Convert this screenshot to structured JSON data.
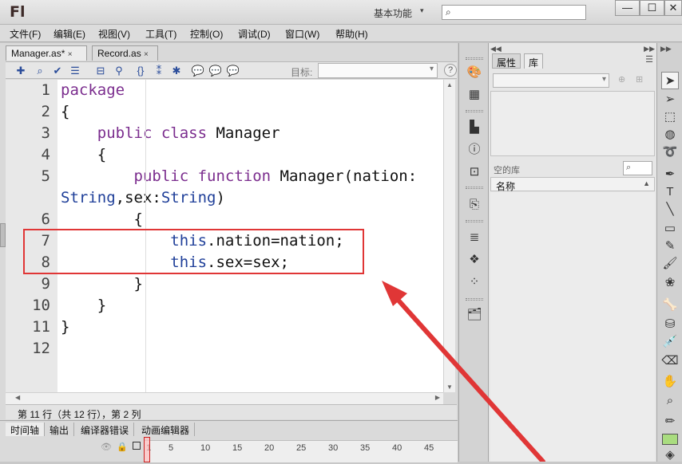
{
  "app": {
    "logo": "Fl",
    "workspace": "基本功能",
    "window_buttons": [
      "—",
      "☐",
      "✕"
    ]
  },
  "menu": [
    "文件(F)",
    "编辑(E)",
    "视图(V)",
    "工具(T)",
    "控制(O)",
    "调试(D)",
    "窗口(W)",
    "帮助(H)"
  ],
  "tabs": [
    {
      "label": "Manager.as*",
      "close": "×"
    },
    {
      "label": "Record.as",
      "close": "×"
    }
  ],
  "editor_toolbar": {
    "target_label": "目标:",
    "target_value": "",
    "help": "?"
  },
  "code": {
    "line_numbers": [
      "1",
      "2",
      "3",
      "4",
      "5",
      "",
      "6",
      "7",
      "8",
      "9",
      "10",
      "11",
      "12"
    ],
    "lines": [
      [
        {
          "t": "package",
          "c": "kw"
        }
      ],
      [
        {
          "t": "{",
          "c": ""
        }
      ],
      [
        {
          "t": "    ",
          "c": ""
        },
        {
          "t": "public class",
          "c": "kw"
        },
        {
          "t": " Manager",
          "c": ""
        }
      ],
      [
        {
          "t": "    {",
          "c": ""
        }
      ],
      [
        {
          "t": "        ",
          "c": ""
        },
        {
          "t": "public function",
          "c": "kw"
        },
        {
          "t": " Manager(nation:",
          "c": ""
        }
      ],
      [
        {
          "t": "String",
          "c": "ty"
        },
        {
          "t": ",sex:",
          "c": ""
        },
        {
          "t": "String",
          "c": "ty"
        },
        {
          "t": ")",
          "c": ""
        }
      ],
      [
        {
          "t": "        {",
          "c": ""
        }
      ],
      [
        {
          "t": "            ",
          "c": ""
        },
        {
          "t": "this",
          "c": "ty"
        },
        {
          "t": ".nation=nation;",
          "c": ""
        }
      ],
      [
        {
          "t": "            ",
          "c": ""
        },
        {
          "t": "this",
          "c": "ty"
        },
        {
          "t": ".sex=sex;",
          "c": ""
        }
      ],
      [
        {
          "t": "        }",
          "c": ""
        }
      ],
      [
        {
          "t": "    }",
          "c": ""
        }
      ],
      [
        {
          "t": "}",
          "c": ""
        }
      ],
      [
        {
          "t": "",
          "c": ""
        }
      ]
    ]
  },
  "status": "第 11 行（共 12 行），第 2 列",
  "bottom_tabs": [
    "时间轴",
    "输出",
    "编译器错误",
    "动画编辑器"
  ],
  "timeline_ruler": [
    "1",
    "5",
    "10",
    "15",
    "20",
    "25",
    "30",
    "35",
    "40",
    "45"
  ],
  "right_panel": {
    "tabs": [
      "属性",
      "库"
    ],
    "empty_library": "空的库",
    "name_column": "名称"
  },
  "colors": {
    "keyword": "#7b2d8e",
    "type": "#1f3f99",
    "highlight": "#e03636",
    "fill_swatch": "#a9dc7f"
  }
}
